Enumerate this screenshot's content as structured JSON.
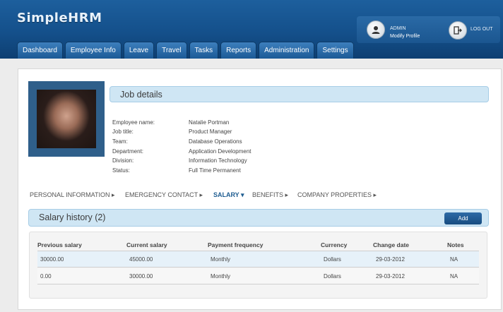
{
  "app": {
    "logo": "SimpleHRM"
  },
  "user": {
    "name": "ADMIN",
    "modify_profile": "Modify Profile",
    "logout": "LOG OUT"
  },
  "nav": {
    "tabs": [
      "Dashboard",
      "Employee Info",
      "Leave",
      "Travel",
      "Tasks",
      "Reports",
      "Administration",
      "Settings"
    ]
  },
  "job_details": {
    "title": "Job details",
    "fields": [
      {
        "label": "Employee name:",
        "value": "Natalie Portman"
      },
      {
        "label": "Job title:",
        "value": "Product Manager"
      },
      {
        "label": "Team:",
        "value": "Database Operations"
      },
      {
        "label": "Department:",
        "value": "Application Development"
      },
      {
        "label": "Division:",
        "value": "Information Technology"
      },
      {
        "label": "Status:",
        "value": "Full Time Permanent"
      }
    ]
  },
  "subnav": {
    "items": [
      {
        "label": "PERSONAL INFORMATION",
        "arrow": "▸"
      },
      {
        "label": "EMERGENCY CONTACT",
        "arrow": "▸"
      },
      {
        "label": "SALARY",
        "arrow": "▾"
      },
      {
        "label": "BENEFITS",
        "arrow": "▸"
      },
      {
        "label": "COMPANY PROPERTIES",
        "arrow": "▸"
      }
    ],
    "active": "SALARY"
  },
  "salary_history": {
    "title": "Salary history (2)",
    "add_label": "Add",
    "columns": [
      "Previous salary",
      "Current salary",
      "Payment frequency",
      "Currency",
      "Change date",
      "Notes"
    ],
    "rows": [
      [
        "30000.00",
        "45000.00",
        "Monthly",
        "Dollars",
        "29-03-2012",
        "NA"
      ],
      [
        "0.00",
        "30000.00",
        "Monthly",
        "Dollars",
        "29-03-2012",
        "NA"
      ]
    ]
  },
  "colors": {
    "header": "#14508b",
    "accent": "#cfe6f4",
    "active_row": "#e6f1f9"
  },
  "icons": {
    "user": "user-icon",
    "logout": "logout-icon"
  }
}
